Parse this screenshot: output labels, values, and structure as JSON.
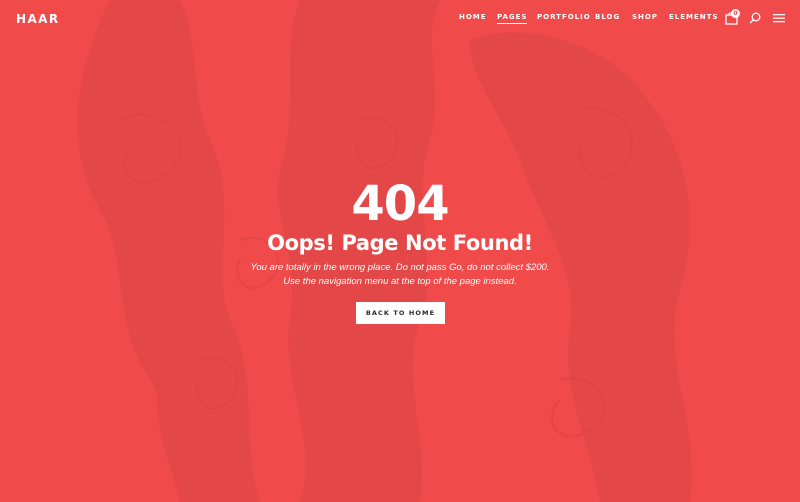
{
  "header": {
    "logo": "HAAR",
    "nav": [
      {
        "label": "HOME",
        "active": false
      },
      {
        "label": "PAGES",
        "active": true
      },
      {
        "label": "PORTFOLIO",
        "active": false
      },
      {
        "label": "BLOG",
        "active": false
      },
      {
        "label": "SHOP",
        "active": false
      },
      {
        "label": "ELEMENTS",
        "active": false
      }
    ],
    "cart_count": "0",
    "icons": [
      "shopping-bag-icon",
      "search-icon",
      "hamburger-menu-icon"
    ]
  },
  "error": {
    "code": "404",
    "title": "Oops! Page Not Found!",
    "line1": "You are totally in the wrong place. Do not pass Go, do not collect $200.",
    "line2": "Use the navigation menu at the top of the page instead.",
    "button_label": "BACK TO HOME"
  },
  "colors": {
    "background": "#f04a4a",
    "art_overlay": "#d94545",
    "text": "#ffffff",
    "button_bg": "#ffffff",
    "button_text": "#2b2b2b"
  }
}
